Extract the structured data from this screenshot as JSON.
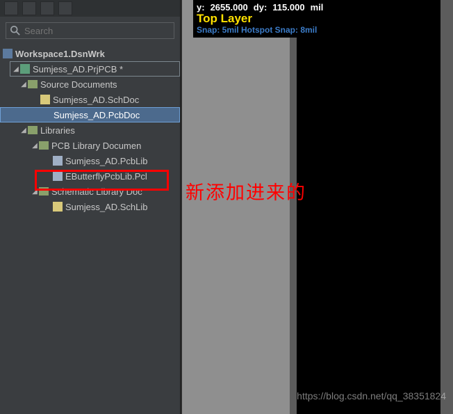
{
  "search": {
    "placeholder": "Search"
  },
  "workspace": "Workspace1.DsnWrk",
  "project": "Sumjess_AD.PrjPCB *",
  "srcFolder": "Source Documents",
  "srcFiles": {
    "sch": "Sumjess_AD.SchDoc",
    "pcb": "Sumjess_AD.PcbDoc"
  },
  "libFolder": "Libraries",
  "pcbLibFolder": "PCB Library Documen",
  "pcbLibFiles": {
    "a": "Sumjess_AD.PcbLib",
    "b": "EButterflyPcbLib.Pcl"
  },
  "schLibFolder": "Schematic Library Doc",
  "schLibFiles": {
    "a": "Sumjess_AD.SchLib"
  },
  "hud": {
    "y_label": "y:",
    "y_val": "2655.000",
    "dy_label": "dy:",
    "dy_val": "115.000",
    "unit": "mil",
    "layer": "Top Layer",
    "snap": "Snap: 5mil Hotspot Snap: 8mil"
  },
  "anno": "新添加进来的",
  "wm": "https://blog.csdn.net/qq_38351824"
}
